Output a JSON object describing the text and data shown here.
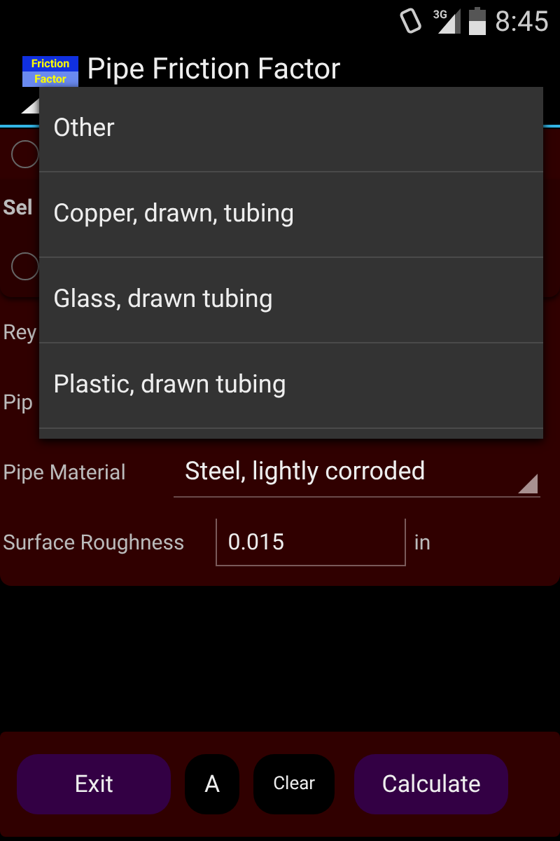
{
  "status_bar": {
    "network": "3G",
    "time": "8:45"
  },
  "action_bar": {
    "logo": [
      "Friction",
      "Factor"
    ],
    "title": "Pipe Friction Factor"
  },
  "form": {
    "rows": [
      {
        "kind": "radio",
        "checked": false
      },
      {
        "kind": "label",
        "label": "Sel"
      },
      {
        "kind": "radio",
        "checked": false
      },
      {
        "kind": "label",
        "label": "Rey"
      },
      {
        "kind": "label",
        "label": "Pip"
      },
      {
        "kind": "select",
        "label": "Pipe Material",
        "value": "Steel, lightly corroded"
      },
      {
        "kind": "input",
        "label": "Surface Roughness",
        "value": "0.015",
        "unit": "in"
      }
    ]
  },
  "dropdown": {
    "options": [
      "Other",
      "Copper, drawn, tubing",
      "Glass, drawn tubing",
      "Plastic, drawn tubing"
    ]
  },
  "buttons": [
    {
      "label": "Exit",
      "kind": "primary"
    },
    {
      "label": "A",
      "kind": "secondary"
    },
    {
      "label": "Clear",
      "kind": "secondary"
    },
    {
      "label": "Calculate",
      "kind": "primary"
    }
  ]
}
